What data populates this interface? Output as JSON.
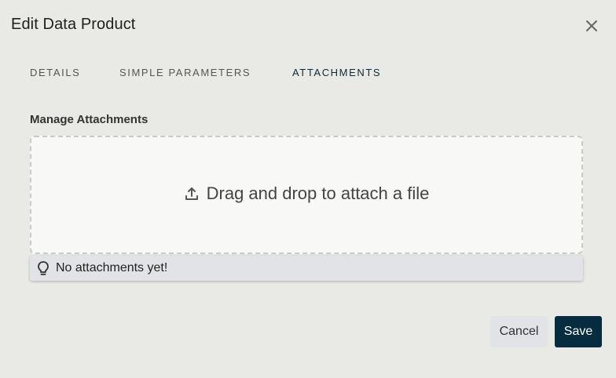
{
  "dialog": {
    "title": "Edit Data Product"
  },
  "tabs": [
    {
      "label": "DETAILS",
      "active": false
    },
    {
      "label": "SIMPLE PARAMETERS",
      "active": false
    },
    {
      "label": "ATTACHMENTS",
      "active": true
    }
  ],
  "attachments": {
    "section_label": "Manage Attachments",
    "dropzone_text": "Drag and drop to attach a file",
    "hint_text": "No attachments yet!"
  },
  "footer": {
    "cancel_label": "Cancel",
    "save_label": "Save"
  },
  "icons": {
    "close": "close-icon",
    "upload": "upload-icon",
    "hint": "lightbulb-icon"
  },
  "colors": {
    "background": "#e9e9e5",
    "primary": "#062c3f",
    "active_tab": "#0d2a3a"
  }
}
